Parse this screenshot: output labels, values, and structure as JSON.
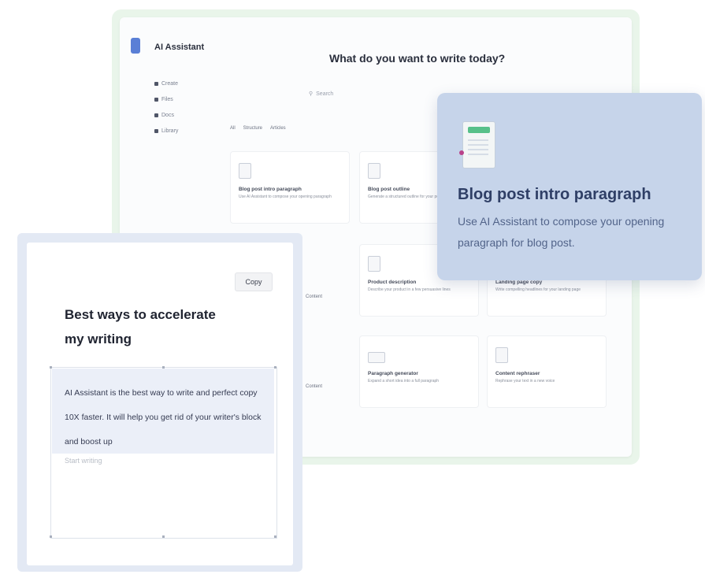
{
  "app": {
    "name": "AI Assistant",
    "heading": "What do you want to write today?",
    "search_placeholder": "Search",
    "nav": [
      "Create",
      "Files",
      "Docs",
      "Library"
    ],
    "filters": [
      "All",
      "Structure",
      "Articles"
    ],
    "cards": [
      {
        "title": "Blog post intro paragraph",
        "desc": "Use AI Assistant to compose your opening paragraph"
      },
      {
        "title": "Blog post outline",
        "desc": "Generate a structured outline for your post"
      },
      {
        "title": "Product description",
        "desc": "Describe your product in a few persuasive lines"
      },
      {
        "title": "Landing page copy",
        "desc": "Write compelling headlines for your landing page"
      },
      {
        "title": "Paragraph generator",
        "desc": "Expand a short idea into a full paragraph"
      },
      {
        "title": "Content rephraser",
        "desc": "Rephrase your text in a new voice"
      }
    ],
    "row_labels": [
      "Content",
      "Content"
    ]
  },
  "tooltip": {
    "title": "Blog post intro paragraph",
    "description": "Use AI Assistant to compose your opening paragraph for blog post."
  },
  "editor": {
    "copy_label": "Copy",
    "title": "Best ways to accelerate my writing",
    "body": "AI Assistant is the best way to write and perfect copy 10X faster. It will help you get rid of your writer's block and boost up",
    "hint": "Start writing"
  },
  "colors": {
    "frame_green": "#e9f5ea",
    "tooltip_bg": "#c6d4ea",
    "accent_blue": "#5a7fd6",
    "accent_green": "#57c089"
  }
}
